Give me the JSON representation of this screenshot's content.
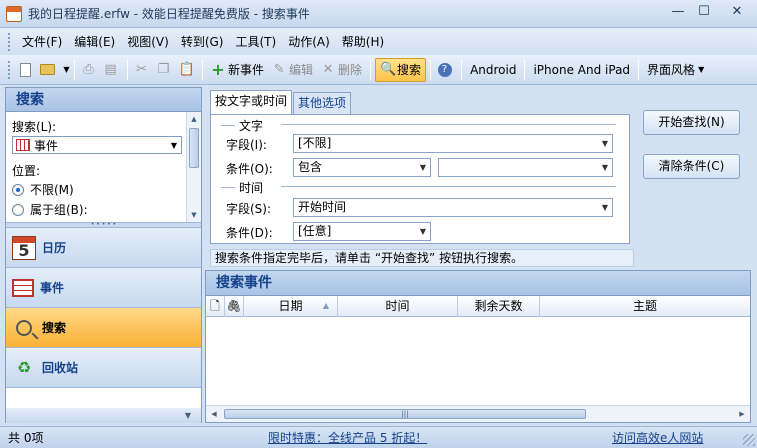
{
  "window": {
    "title": "我的日程提醒.erfw - 效能日程提醒免费版 - 搜索事件",
    "minimize": "—",
    "maximize": "☐",
    "close": "✕"
  },
  "menu": [
    "文件(F)",
    "编辑(E)",
    "视图(V)",
    "转到(G)",
    "工具(T)",
    "动作(A)",
    "帮助(H)"
  ],
  "toolbar": {
    "new_event": "新事件",
    "edit": "编辑",
    "delete": "删除",
    "search": "搜索",
    "android": "Android",
    "iphone": "iPhone And iPad",
    "style": "界面风格"
  },
  "nav": {
    "header": "搜索",
    "search_label": "搜索(L):",
    "search_value": "事件",
    "position_label": "位置:",
    "radio_unlimited": "不限(M)",
    "radio_group": "属于组(B):",
    "items": [
      {
        "label": "日历",
        "icon": "calendar-icon"
      },
      {
        "label": "事件",
        "icon": "event-icon"
      },
      {
        "label": "搜索",
        "icon": "search-icon"
      },
      {
        "label": "回收站",
        "icon": "recycle-icon"
      }
    ],
    "calendar_day": "5"
  },
  "search": {
    "tab_text_time": "按文字或时间",
    "tab_other": "其他选项",
    "group_text": "文字",
    "field_label": "字段(I):",
    "field_value": "[不限]",
    "condition_label": "条件(O):",
    "condition_value": "包含",
    "condition_text": "",
    "group_time": "时间",
    "time_field_label": "字段(S):",
    "time_field_value": "开始时间",
    "time_condition_label": "条件(D):",
    "time_condition_value": "[任意]",
    "start_button": "开始查找(N)",
    "clear_button": "清除条件(C)",
    "hint": "搜索条件指定完毕后，请单击 “开始查找” 按钮执行搜索。"
  },
  "results": {
    "header": "搜索事件",
    "columns": [
      "",
      "",
      "日期",
      "时间",
      "剩余天数",
      "主题"
    ]
  },
  "status": {
    "count": "共 0项",
    "promo": "限时特惠：全线产品 5 折起！",
    "site": "访问高效e人网站"
  }
}
